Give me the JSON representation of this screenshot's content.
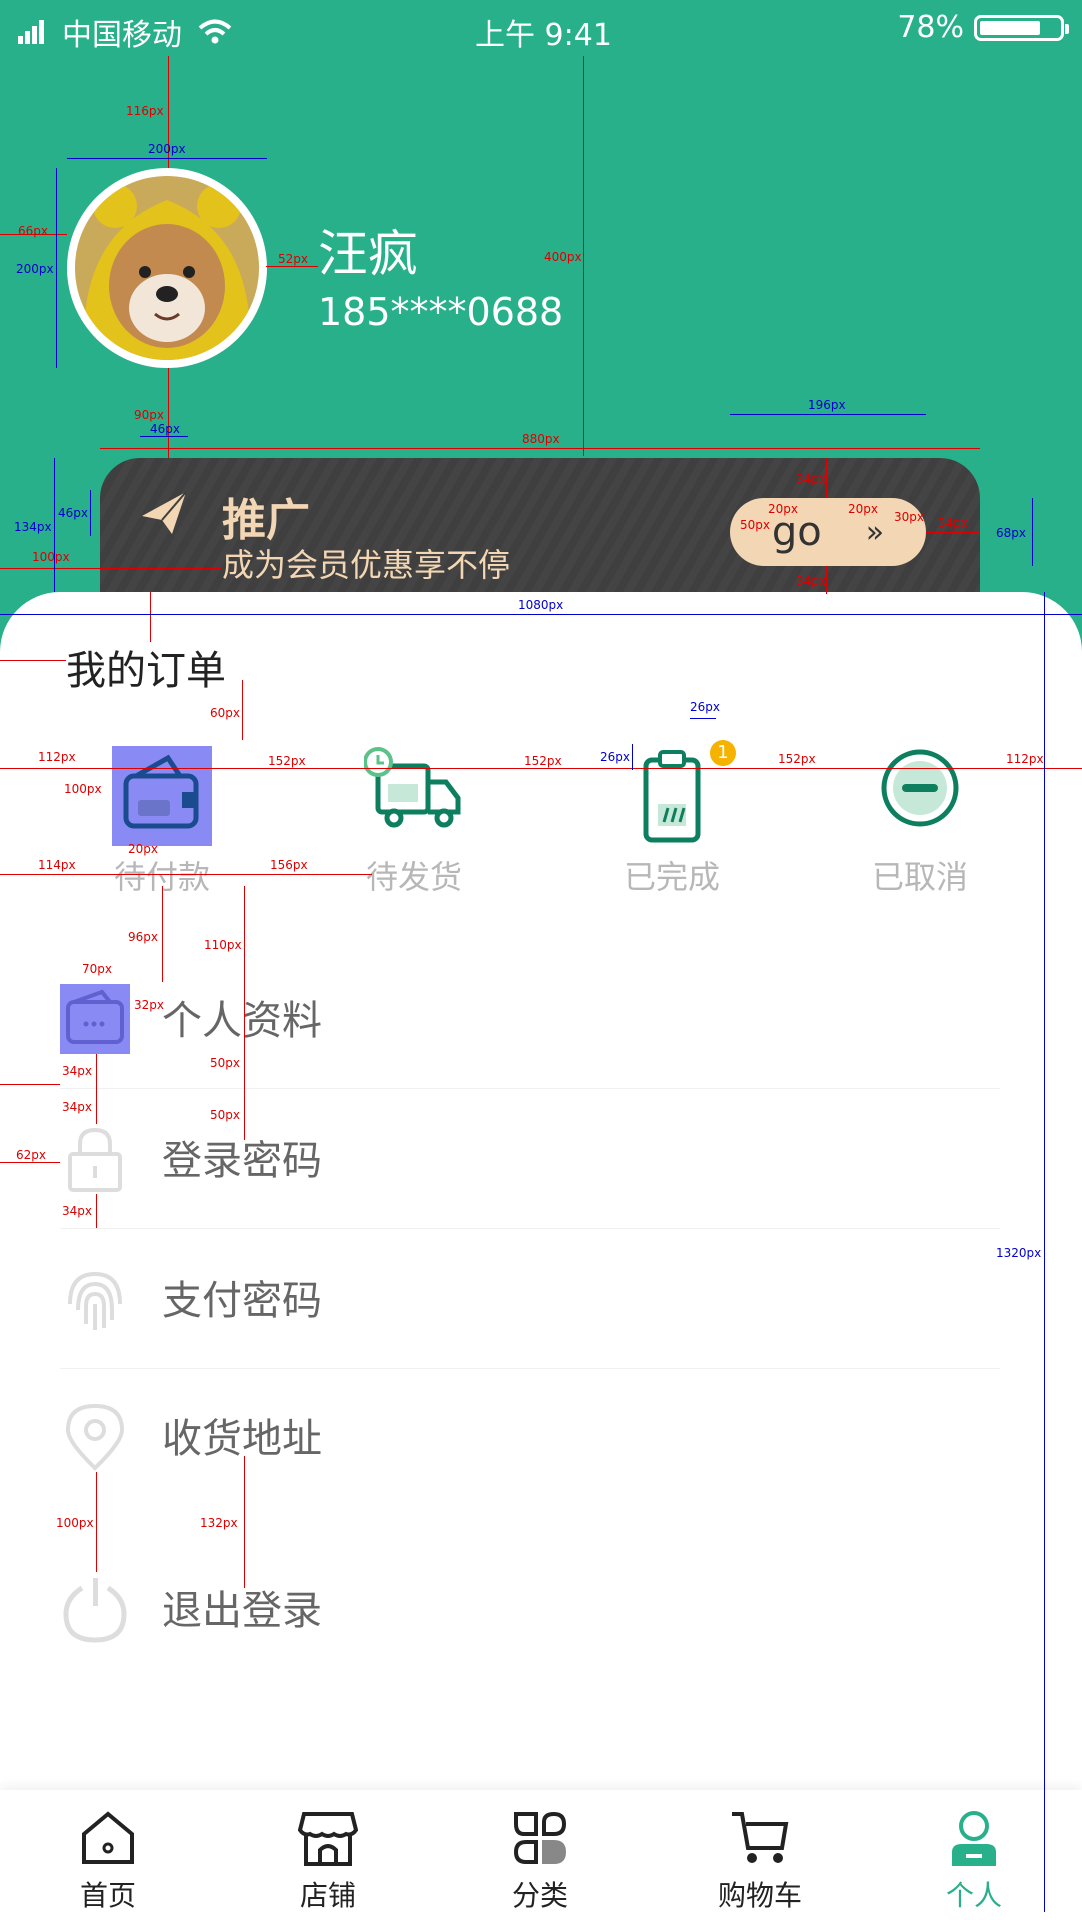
{
  "status_bar": {
    "carrier": "中国移动",
    "time": "上午 9:41",
    "battery": "78%",
    "battery_level": 0.78
  },
  "profile": {
    "name": "汪疯",
    "phone": "185****0688"
  },
  "promo": {
    "title": "推广",
    "subtitle": "成为会员优惠享不停",
    "button_label": "go"
  },
  "orders": {
    "title": "我的订单",
    "items": [
      {
        "label": "待付款"
      },
      {
        "label": "待发货"
      },
      {
        "label": "已完成",
        "badge": "1"
      },
      {
        "label": "已取消"
      }
    ]
  },
  "menu": [
    {
      "label": "个人资料",
      "icon": "wallet-icon"
    },
    {
      "label": "登录密码",
      "icon": "lock-icon"
    },
    {
      "label": "支付密码",
      "icon": "fingerprint-icon"
    },
    {
      "label": "收货地址",
      "icon": "location-icon"
    },
    {
      "label": "退出登录",
      "icon": "power-icon"
    }
  ],
  "tabbar": [
    {
      "label": "首页",
      "icon": "home-icon"
    },
    {
      "label": "店铺",
      "icon": "store-icon"
    },
    {
      "label": "分类",
      "icon": "category-icon"
    },
    {
      "label": "购物车",
      "icon": "cart-icon"
    },
    {
      "label": "个人",
      "icon": "person-icon",
      "active": true
    }
  ],
  "colors": {
    "primary": "#28b08a",
    "promo_bg": "#3f3f3f",
    "promo_text": "#f3d7b5",
    "badge": "#f5b300"
  },
  "annotations": {
    "red": [
      "116px",
      "66px",
      "52px",
      "400px",
      "90px",
      "880px",
      "34px",
      "20px",
      "50px",
      "30px",
      "54px",
      "100px",
      "60px",
      "112px",
      "152px",
      "152px",
      "152px",
      "112px",
      "100px",
      "20px",
      "114px",
      "156px",
      "96px",
      "110px",
      "70px",
      "32px",
      "34px",
      "34px",
      "62px",
      "34px",
      "50px",
      "50px",
      "100px",
      "132px",
      "34px",
      "20px"
    ],
    "blue": [
      "200px",
      "200px",
      "196px",
      "46px",
      "134px",
      "46px",
      "68px",
      "1080px",
      "26px",
      "26px",
      "1320px"
    ]
  }
}
